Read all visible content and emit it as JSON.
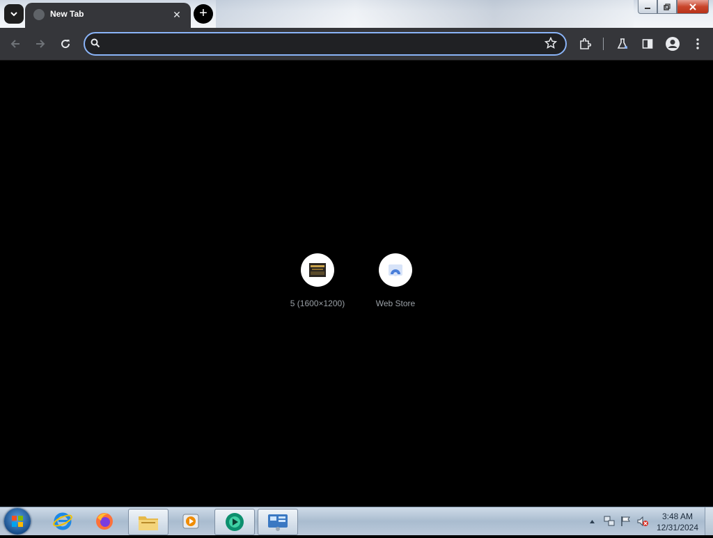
{
  "browser": {
    "tab_title": "New Tab",
    "new_tab_symbol": "+",
    "close_symbol": "✕",
    "omnibox": {
      "value": "",
      "placeholder": ""
    },
    "colors": {
      "accent": "#8ab4f8",
      "toolbar": "#35363a",
      "background": "#000000"
    }
  },
  "shortcuts": [
    {
      "label": "5 (1600×1200)",
      "icon": "image-thumbnail-icon"
    },
    {
      "label": "Web Store",
      "icon": "web-store-icon"
    }
  ],
  "taskbar": {
    "apps": [
      "internet-explorer-icon",
      "firefox-icon",
      "file-explorer-icon",
      "media-player-icon",
      "browser-app-icon",
      "control-panel-icon"
    ],
    "time": "3:48 AM",
    "date": "12/31/2024"
  }
}
